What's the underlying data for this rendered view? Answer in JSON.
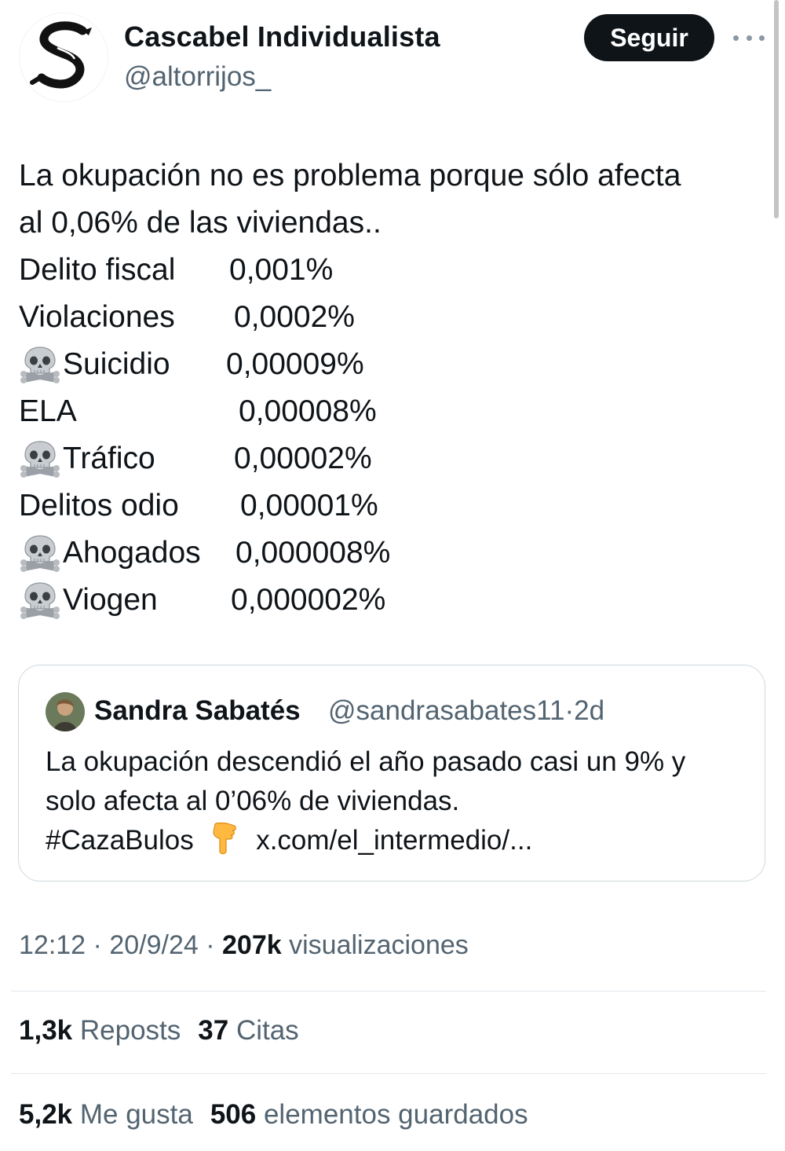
{
  "author": {
    "display_name": "Cascabel Individualista",
    "handle": "@altorrijos_"
  },
  "follow_button": {
    "label": "Seguir"
  },
  "more_icon": "more-horizontal-icon",
  "tweet": {
    "intro_line1": "La okupación no es problema porque sólo afecta",
    "intro_line2": "al 0,06% de las viviendas..",
    "stats": [
      {
        "skull": false,
        "label": "Delito fiscal",
        "value": "0,001%"
      },
      {
        "skull": false,
        "label": "Violaciones",
        "value": "0,0002%"
      },
      {
        "skull": true,
        "label": "Suicidio",
        "value": "0,00009%"
      },
      {
        "skull": false,
        "label": "ELA",
        "value": "0,00008%"
      },
      {
        "skull": true,
        "label": "Tráfico",
        "value": "0,00002%"
      },
      {
        "skull": false,
        "label": "Delitos odio",
        "value": "0,00001%"
      },
      {
        "skull": true,
        "label": "Ahogados",
        "value": "0,000008%"
      },
      {
        "skull": true,
        "label": "Viogen",
        "value": "0,000002%"
      }
    ]
  },
  "quoted_tweet": {
    "display_name": "Sandra Sabatés",
    "handle": "@sandrasabates11",
    "separator": "·",
    "age": "2d",
    "line1": "La okupación descendió el año pasado casi un 9% y",
    "line2": "solo afecta al 0’06% de viviendas.",
    "hashtag": "#CazaBulos",
    "link": "x.com/el_intermedio/..."
  },
  "meta": {
    "time": "12:12",
    "separator": "·",
    "date": "20/9/24",
    "views_count": "207k",
    "views_label": "visualizaciones"
  },
  "engagement": {
    "reposts_count": "1,3k",
    "reposts_label": "Reposts",
    "quotes_count": "37",
    "quotes_label": "Citas",
    "likes_count": "5,2k",
    "likes_label": "Me gusta",
    "bookmarks_count": "506",
    "bookmarks_label": "elementos guardados"
  }
}
